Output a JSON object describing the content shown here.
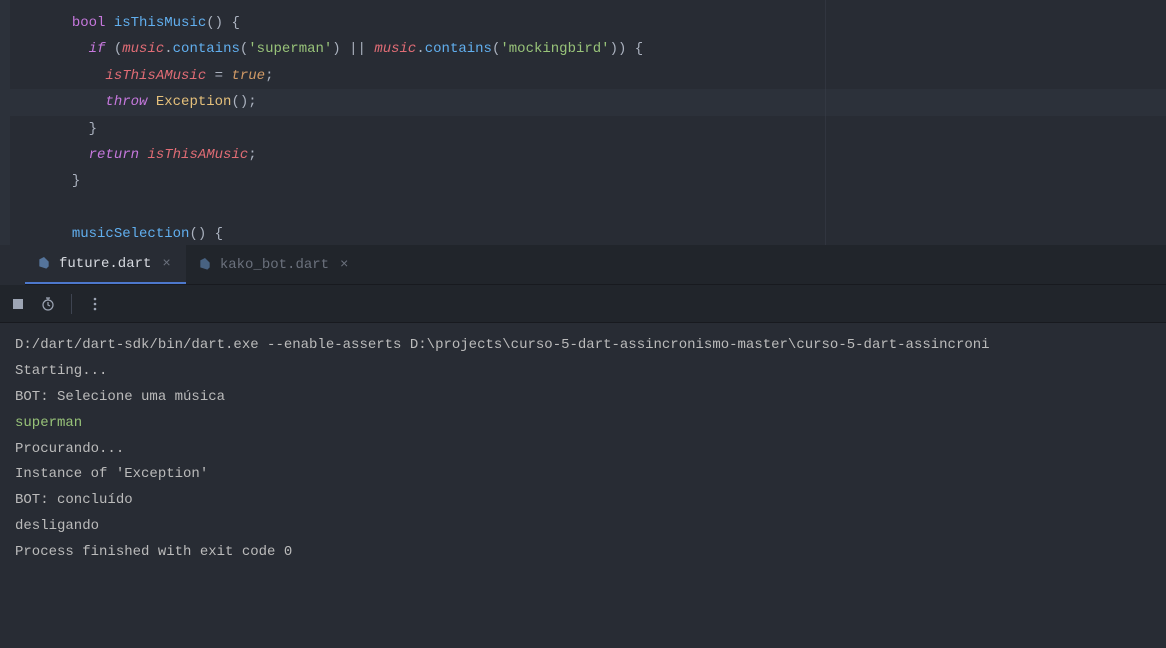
{
  "code": {
    "line1": {
      "indent": "  ",
      "kw": "bool",
      "fn": "isThisMusic",
      "parens": "() {"
    },
    "line2": {
      "indent": "    ",
      "kw": "if",
      "open": " (",
      "var1": "music",
      "dot1": ".",
      "method1": "contains",
      "str1": "'superman'",
      "or": " || ",
      "var2": "music",
      "dot2": ".",
      "method2": "contains",
      "str2": "'mockingbird'",
      "close": ")) {"
    },
    "line3": {
      "indent": "      ",
      "var": "isThisAMusic",
      "assign": " = ",
      "val": "true",
      "semi": ";"
    },
    "line4": {
      "indent": "      ",
      "kw": "throw",
      "sp": " ",
      "cls": "Exception",
      "call": "();"
    },
    "line5": {
      "indent": "    ",
      "brace": "}"
    },
    "line6": {
      "indent": "    ",
      "kw": "return",
      "sp": " ",
      "var": "isThisAMusic",
      "semi": ";"
    },
    "line7": {
      "indent": "  ",
      "brace": "}"
    },
    "line9": {
      "indent": "  ",
      "fn": "musicSelection",
      "parens": "() {"
    }
  },
  "tabs": [
    {
      "label": "future.dart",
      "active": true
    },
    {
      "label": "kako_bot.dart",
      "active": false
    }
  ],
  "console": {
    "cmd": "D:/dart/dart-sdk/bin/dart.exe --enable-asserts D:\\projects\\curso-5-dart-assincronismo-master\\curso-5-dart-assincroni",
    "lines": [
      "Starting...",
      "BOT: Selecione uma música"
    ],
    "input": "superman",
    "lines2": [
      "Procurando...",
      "",
      "Instance of 'Exception'",
      "BOT: concluído",
      "desligando",
      "",
      "Process finished with exit code 0"
    ]
  }
}
